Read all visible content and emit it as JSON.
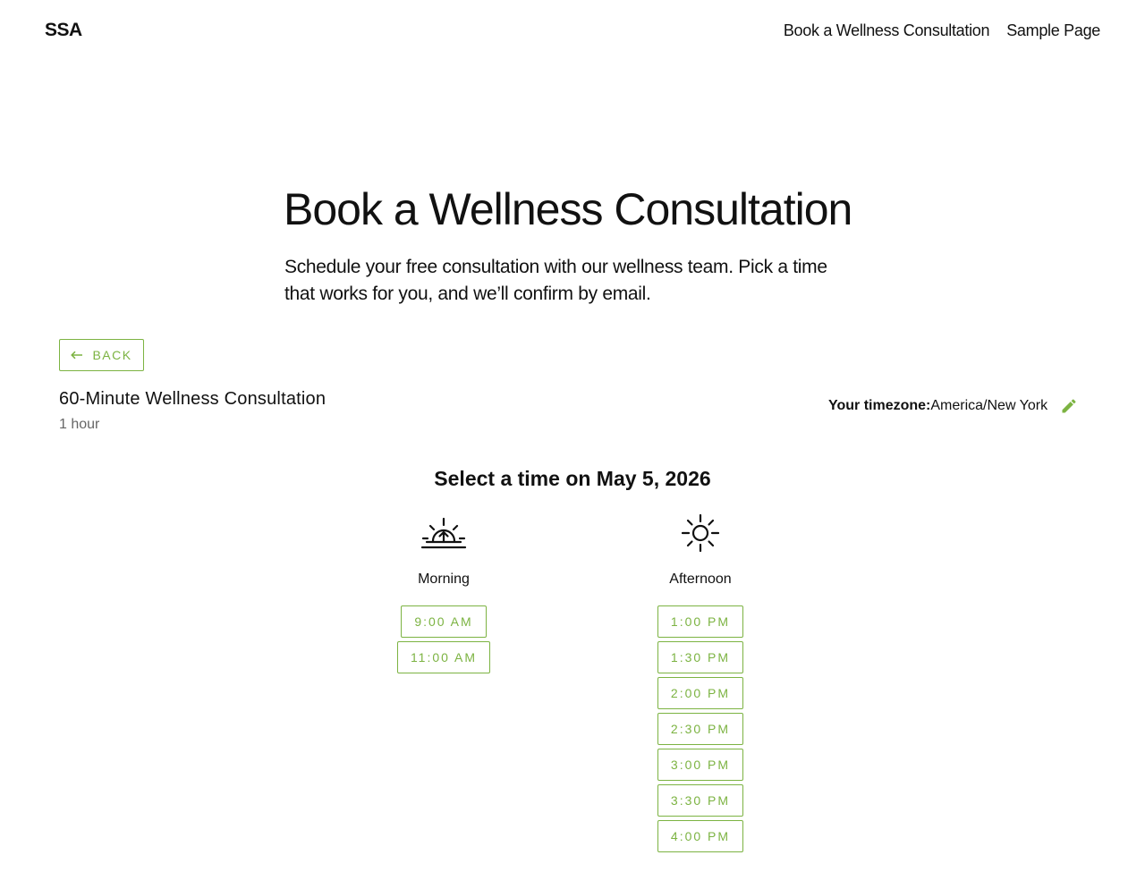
{
  "header": {
    "logo": "SSA",
    "nav": [
      "Book a Wellness Consultation",
      "Sample Page"
    ]
  },
  "hero": {
    "title": "Book a Wellness Consultation",
    "subtitle": "Schedule your free consultation with our wellness team. Pick a time that works for you, and we’ll confirm by email."
  },
  "booking": {
    "back_label": "BACK",
    "service_name": "60-Minute Wellness Consultation",
    "duration": "1 hour",
    "timezone_label": "Your timezone:",
    "timezone_value": "America/New York",
    "select_heading": "Select a time on May 5, 2026",
    "morning": {
      "label": "Morning",
      "icon": "sunrise-icon",
      "slots": [
        "9:00 AM",
        "11:00 AM"
      ]
    },
    "afternoon": {
      "label": "Afternoon",
      "icon": "sun-icon",
      "slots": [
        "1:00 PM",
        "1:30 PM",
        "2:00 PM",
        "2:30 PM",
        "3:00 PM",
        "3:30 PM",
        "4:00 PM"
      ]
    }
  },
  "colors": {
    "accent": "#7cb342",
    "text": "#111111",
    "muted": "#666666"
  }
}
